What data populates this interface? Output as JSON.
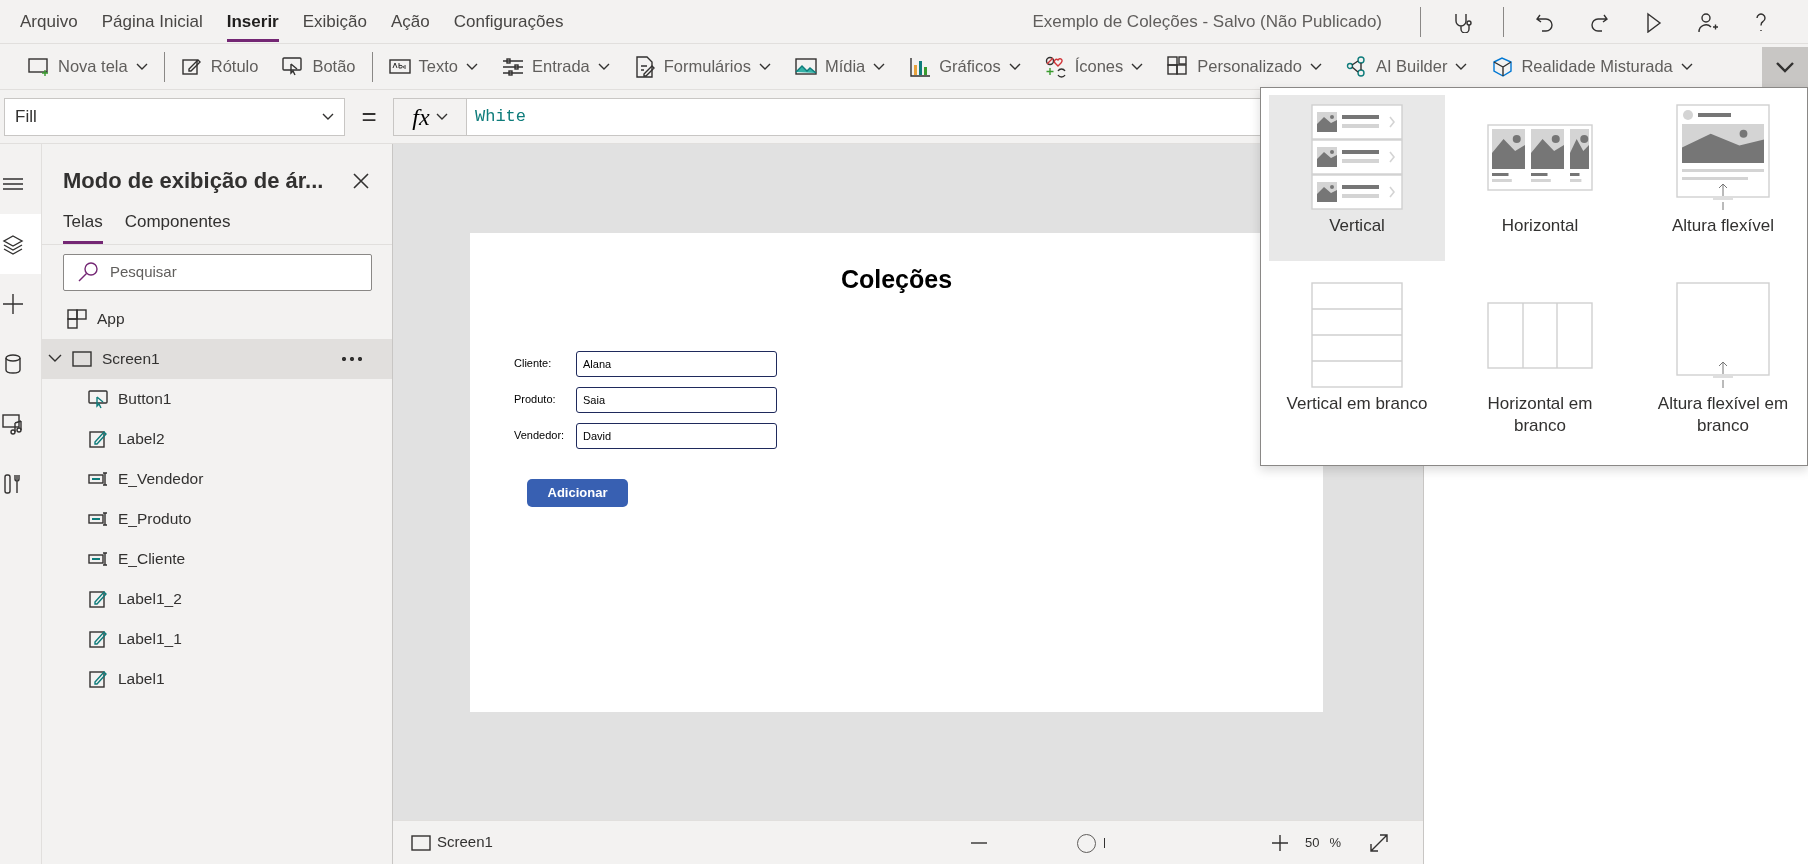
{
  "menu": [
    {
      "label": "Arquivo",
      "selected": false
    },
    {
      "label": "Página Inicial",
      "selected": false
    },
    {
      "label": "Inserir",
      "selected": true
    },
    {
      "label": "Exibição",
      "selected": false
    },
    {
      "label": "Ação",
      "selected": false
    },
    {
      "label": "Configurações",
      "selected": false
    }
  ],
  "title": "Exemplo de Coleções - Salvo (Não Publicado)",
  "title_actions": [
    {
      "kind": "checker"
    },
    {
      "kind": "undo"
    },
    {
      "kind": "redo"
    },
    {
      "kind": "play"
    },
    {
      "kind": "share"
    },
    {
      "kind": "help"
    }
  ],
  "toolbar": [
    {
      "kind": "newscreen",
      "label": "Nova tela",
      "dropdown": true
    },
    {
      "kind": "label",
      "label": "Rótulo",
      "dropdown": false
    },
    {
      "kind": "button",
      "label": "Botão",
      "dropdown": false
    },
    {
      "kind": "text",
      "label": "Texto",
      "dropdown": true
    },
    {
      "kind": "input",
      "label": "Entrada",
      "dropdown": true
    },
    {
      "kind": "forms",
      "label": "Formulários",
      "dropdown": true
    },
    {
      "kind": "media",
      "label": "Mídia",
      "dropdown": true
    },
    {
      "kind": "charts",
      "label": "Gráficos",
      "dropdown": true
    },
    {
      "kind": "icons",
      "label": "Ícones",
      "dropdown": true
    },
    {
      "kind": "custom",
      "label": "Personalizado",
      "dropdown": true
    },
    {
      "kind": "ai",
      "label": "AI Builder",
      "dropdown": true
    },
    {
      "kind": "mixed",
      "label": "Realidade Misturada",
      "dropdown": true
    }
  ],
  "formula": {
    "property": "Fill",
    "equals": "=",
    "fx": "fx",
    "value": "White"
  },
  "rail": [
    {
      "kind": "menu",
      "selected": false
    },
    {
      "kind": "layers",
      "selected": true
    },
    {
      "kind": "plus",
      "selected": false
    },
    {
      "kind": "data",
      "selected": false
    },
    {
      "kind": "media",
      "selected": false
    },
    {
      "kind": "tools",
      "selected": false
    }
  ],
  "panel": {
    "title": "Modo de exibição de ár...",
    "tabs": [
      {
        "label": "Telas",
        "selected": true
      },
      {
        "label": "Componentes",
        "selected": false
      }
    ],
    "search": {
      "placeholder": "Pesquisar"
    },
    "tree": [
      {
        "kind": "app",
        "label": "App",
        "selected": false
      },
      {
        "kind": "screen",
        "label": "Screen1",
        "selected": true,
        "expanded": true,
        "children": [
          {
            "kind": "button",
            "label": "Button1",
            "selected": false
          },
          {
            "kind": "label",
            "label": "Label2",
            "selected": false
          },
          {
            "kind": "input",
            "label": "E_Vendedor",
            "selected": false
          },
          {
            "kind": "input",
            "label": "E_Produto",
            "selected": false
          },
          {
            "kind": "input",
            "label": "E_Cliente",
            "selected": false
          },
          {
            "kind": "label",
            "label": "Label1_2",
            "selected": false
          },
          {
            "kind": "label",
            "label": "Label1_1",
            "selected": false
          },
          {
            "kind": "label",
            "label": "Label1",
            "selected": false
          }
        ]
      }
    ]
  },
  "canvas": {
    "title": "Coleções",
    "fields": [
      {
        "label": "Cliente:",
        "value": "Alana"
      },
      {
        "label": "Produto:",
        "value": "Saia"
      },
      {
        "label": "Vendedor:",
        "value": "David"
      }
    ],
    "button": "Adicionar"
  },
  "gallery_menu": [
    {
      "kind": "vertical",
      "label": "Vertical",
      "selected": true
    },
    {
      "kind": "horizontal",
      "label": "Horizontal",
      "selected": false
    },
    {
      "kind": "flexible",
      "label": "Altura flexível",
      "selected": false
    },
    {
      "kind": "vertical_blank",
      "label": "Vertical em branco",
      "selected": false
    },
    {
      "kind": "horizontal_blank",
      "label": "Horizontal em branco",
      "selected": false
    },
    {
      "kind": "flexible_blank",
      "label": "Altura flexível em branco",
      "selected": false
    }
  ],
  "status_bar": {
    "screen": "Screen1",
    "zoom": {
      "level": 0.3,
      "value": "50",
      "unit": "%"
    }
  }
}
